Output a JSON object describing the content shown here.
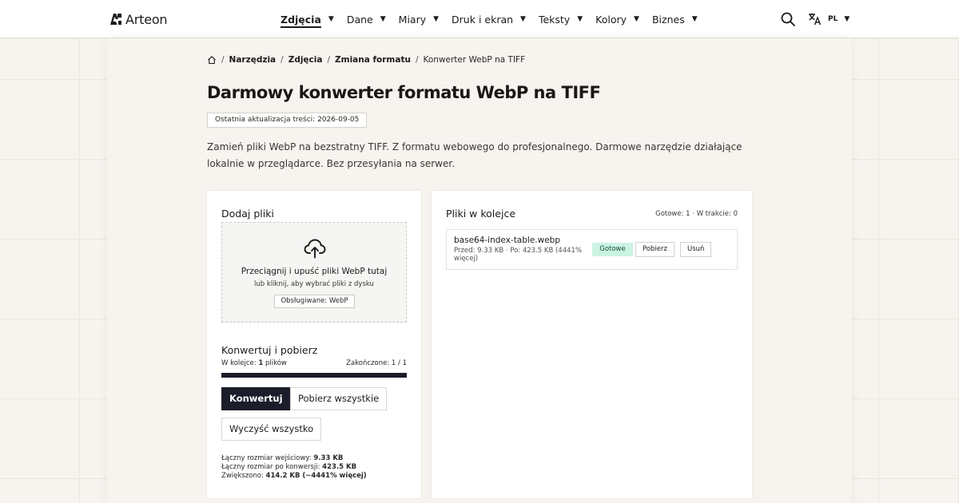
{
  "header": {
    "logo_text": "Arteon",
    "nav": [
      {
        "label": "Zdjęcia",
        "active": true
      },
      {
        "label": "Dane"
      },
      {
        "label": "Miary"
      },
      {
        "label": "Druk i ekran"
      },
      {
        "label": "Teksty"
      },
      {
        "label": "Kolory"
      },
      {
        "label": "Biznes"
      }
    ],
    "caret": "▼",
    "search_icon": "search-icon",
    "language_icon": "translate-icon",
    "language_code": "PL"
  },
  "breadcrumb": {
    "home_icon": "home-icon",
    "separator": "/",
    "items": [
      "Narzędzia",
      "Zdjęcia",
      "Zmiana formatu"
    ],
    "current": "Konwerter WebP na TIFF"
  },
  "page": {
    "title": "Darmowy konwerter formatu WebP na TIFF",
    "updated": "Ostatnia aktualizacja treści: 2026-09-05",
    "intro": "Zamień pliki WebP na bezstratny TIFF. Z formatu webowego do profesjonalnego. Darmowe narzędzie działające lokalnie w przeglądarce. Bez przesyłania na serwer."
  },
  "upload": {
    "title": "Dodaj pliki",
    "icon": "cloud-upload-icon",
    "drop_title": "Przeciągnij i upuść pliki WebP tutaj",
    "drop_sub": "lub kliknij, aby wybrać pliki z dysku",
    "supported": "Obsługiwane: WebP"
  },
  "convert": {
    "title": "Konwertuj i pobierz",
    "queue_prefix": "W kolejce: ",
    "queue_count": "1",
    "queue_suffix": " plików",
    "done_label": "Zakończone: 1 / 1",
    "progress": 1,
    "convert_label": "Konwertuj",
    "download_all_label": "Pobierz wszystkie",
    "clear_label": "Wyczyść wszystko",
    "totals": {
      "input_label": "Łączny rozmiar wejściowy: ",
      "input_value": "9.33 KB",
      "output_label": "Łączny rozmiar po konwersji: ",
      "output_value": "423.5 KB",
      "change_label": "Zwiększono: ",
      "change_value": "414.2 KB (~4441% więcej)"
    }
  },
  "queue": {
    "title": "Pliki w kolejce",
    "status": "Gotowe: 1 · W trakcie: 0",
    "files": [
      {
        "name": "base64-index-table.webp",
        "meta": "Przed: 9.33 KB · Po: 423.5 KB (4441% więcej)",
        "status": "Gotowe",
        "download_label": "Pobierz",
        "remove_label": "Usuń"
      }
    ]
  },
  "colors": {
    "accent_dark": "#1c1d2b",
    "ready_badge": "#cbf3e3",
    "background": "#f7f4ef"
  }
}
